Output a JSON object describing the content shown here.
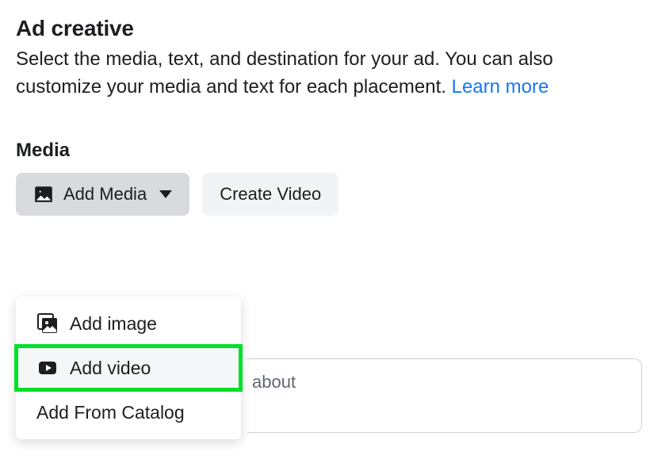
{
  "header": {
    "title": "Ad creative",
    "description_prefix": "Select the media, text, and destination for your ad. You can also customize your media and text for each placement. ",
    "learn_more_label": "Learn more"
  },
  "media": {
    "title": "Media",
    "add_media_label": "Add Media",
    "create_video_label": "Create Video"
  },
  "dropdown": {
    "items": [
      {
        "label": "Add image",
        "icon": "image-icon"
      },
      {
        "label": "Add video",
        "icon": "video-icon",
        "highlighted": true
      },
      {
        "label": "Add From Catalog",
        "icon": ""
      }
    ]
  },
  "textarea": {
    "placeholder_visible": "about"
  },
  "colors": {
    "link": "#1877f2",
    "highlight": "#00e026",
    "text": "#1c1e21"
  }
}
